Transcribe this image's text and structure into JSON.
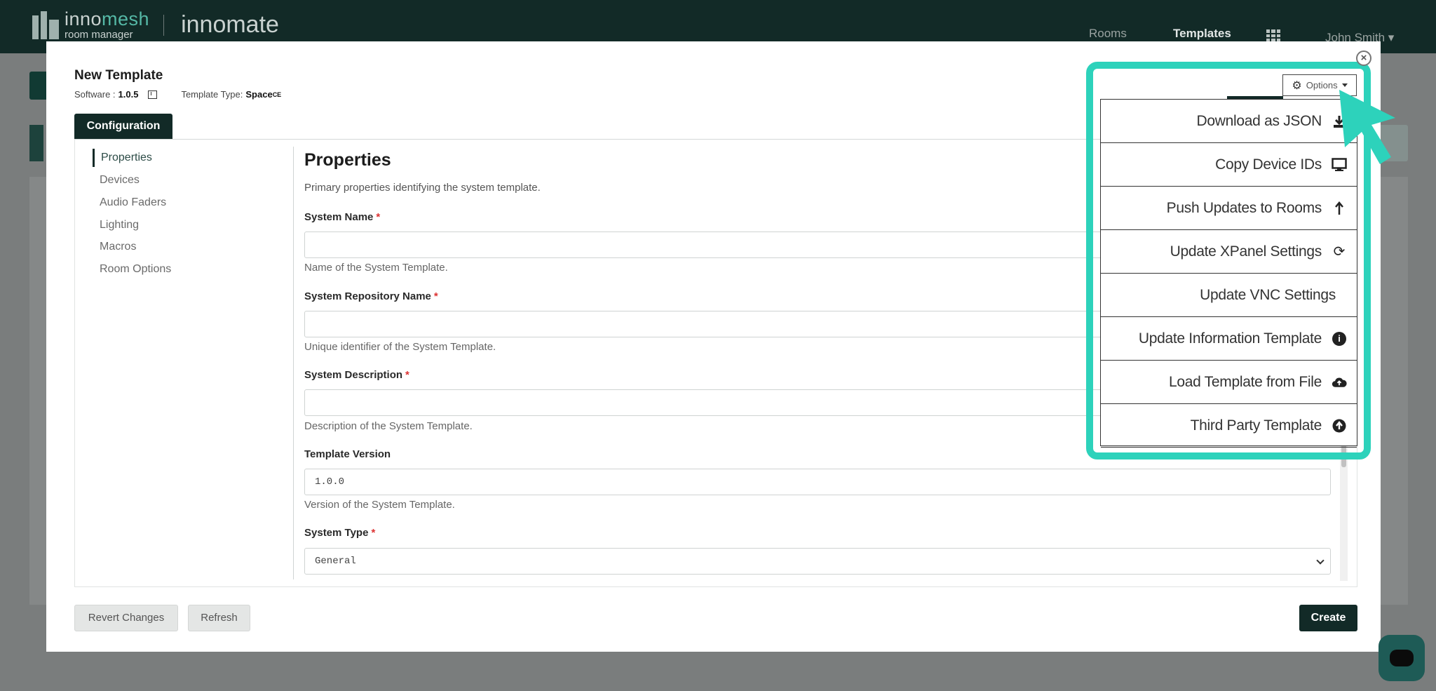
{
  "navbar": {
    "brand_name_prefix": "inno",
    "brand_name_suffix": "mesh",
    "brand_tagline": "room manager",
    "product_name": "innomate",
    "links": [
      "Rooms",
      "Templates"
    ],
    "user_name": "John Smith"
  },
  "modal": {
    "title": "New Template",
    "software_label": "Software :",
    "software_version": "1.0.5",
    "template_type_label": "Template Type:",
    "template_type_value": "Space",
    "template_type_sup": "CE",
    "tab_label": "Configuration",
    "close_symbol": "×",
    "side_nav": [
      "Properties",
      "Devices",
      "Audio Faders",
      "Lighting",
      "Macros",
      "Room Options"
    ],
    "section_title": "Properties",
    "section_desc": "Primary properties identifying the system template.",
    "fields": [
      {
        "label": "System Name",
        "required": "*",
        "value": "",
        "help": "Name of the System Template."
      },
      {
        "label": "System Repository Name",
        "required": "*",
        "value": "",
        "help": "Unique identifier of the System Template."
      },
      {
        "label": "System Description",
        "required": "*",
        "value": "",
        "help": "Description of the System Template."
      },
      {
        "label": "Template Version",
        "required": "",
        "value": "1.0.0",
        "help": "Version of the System Template."
      },
      {
        "label": "System Type",
        "required": "*",
        "value": "General",
        "help": ""
      }
    ],
    "buttons": {
      "revert": "Revert Changes",
      "refresh": "Refresh",
      "create": "Create"
    }
  },
  "options": {
    "label": "Options",
    "items": [
      {
        "label": "Download as JSON",
        "icon": "download-icon"
      },
      {
        "label": "Copy Device IDs",
        "icon": "monitor-icon"
      },
      {
        "label": "Push Updates to Rooms",
        "icon": "arrow-up-icon"
      },
      {
        "label": "Update XPanel Settings",
        "icon": "refresh-icon"
      },
      {
        "label": "Update VNC Settings",
        "icon": ""
      },
      {
        "label": "Update Information Template",
        "icon": "info-icon"
      },
      {
        "label": "Load Template from File",
        "icon": "cloud-upload-icon"
      },
      {
        "label": "Third Party Template",
        "icon": "arrow-circle-up-icon"
      }
    ]
  },
  "colors": {
    "primary_dark": "#122a27",
    "highlight": "#2dd2bb",
    "brand_accent": "#55b8a6",
    "required": "#d33"
  }
}
